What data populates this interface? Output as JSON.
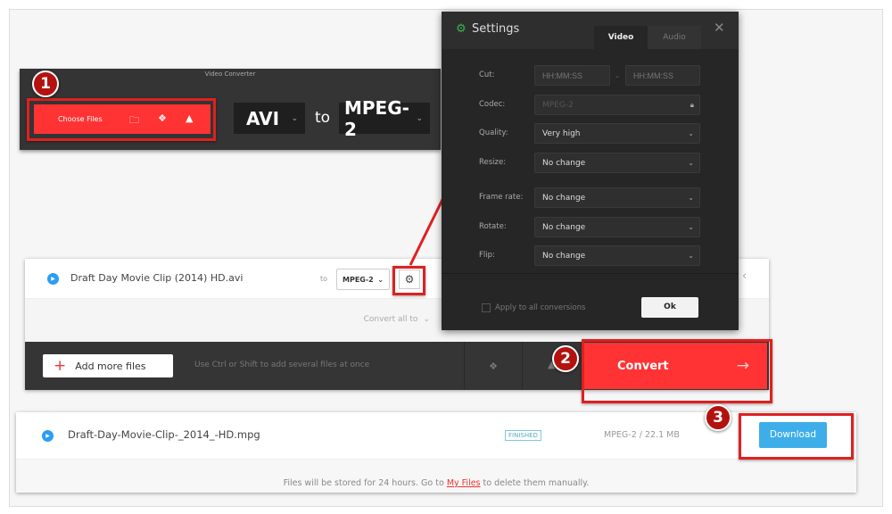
{
  "top_panel": {
    "title": "Video Converter",
    "choose_files": "Choose Files",
    "from_format": "AVI",
    "to_label": "to",
    "to_format": "MPEG-2",
    "icons": [
      "folder-search-icon",
      "dropbox-icon",
      "google-drive-icon"
    ]
  },
  "file_card": {
    "file_name": "Draft Day Movie Clip (2014) HD.avi",
    "to_label": "to",
    "format": "MPEG-2",
    "convert_all": "Convert all to",
    "add_more": "Add more files",
    "hint": "Use Ctrl or Shift to add several files at once",
    "convert": "Convert"
  },
  "settings": {
    "title": "Settings",
    "tabs": [
      "Video",
      "Audio"
    ],
    "active_tab": "Video",
    "fields": [
      {
        "label": "Cut:",
        "start_placeholder": "HH:MM:SS",
        "end_placeholder": "HH:MM:SS",
        "separator": "-"
      },
      {
        "label": "Codec:",
        "value": "MPEG-2"
      },
      {
        "label": "Quality:",
        "value": "Very high"
      },
      {
        "label": "Resize:",
        "value": "No change"
      },
      {
        "label": "Frame rate:",
        "value": "No change"
      },
      {
        "label": "Rotate:",
        "value": "No change"
      },
      {
        "label": "Flip:",
        "value": "No change"
      }
    ],
    "apply_all": "Apply to all conversions",
    "ok": "Ok"
  },
  "result": {
    "file_name": "Draft-Day-Movie-Clip-_2014_-HD.mpg",
    "status": "FINISHED",
    "info": "MPEG-2 / 22.1 MB",
    "download": "Download",
    "footer_pre": "Files will be stored for 24 hours. Go to",
    "footer_link": "My Files",
    "footer_post": "to delete them manually."
  },
  "badges": [
    "1",
    "2",
    "3"
  ],
  "colors": {
    "accent_red": "#ff3333",
    "download_blue": "#3daee9",
    "annotation_red": "#e02020"
  }
}
